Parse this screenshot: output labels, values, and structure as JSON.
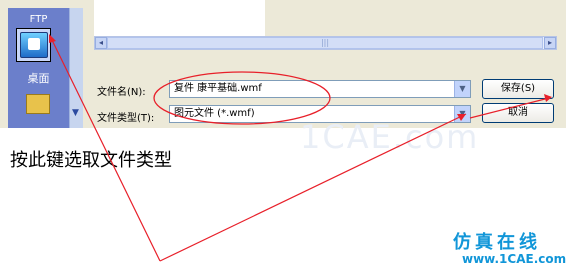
{
  "places_bar": {
    "top_label": "FTP",
    "desktop_label": "桌面"
  },
  "dialog": {
    "filename_label": "文件名(N):",
    "filename_value": "复件 康平基础.wmf",
    "filetype_label": "文件类型(T):",
    "filetype_value": "图元文件 (*.wmf)",
    "save_button": "保存(S)",
    "cancel_button": "取消"
  },
  "caption": "按此键选取文件类型",
  "watermark": {
    "text": "1CAE.com"
  },
  "logo": {
    "text": "仿真在线",
    "url": "www.1CAE.com"
  },
  "colors": {
    "annotation": "#e8202a",
    "logo": "#1196d8",
    "places_bar": "#6b7fcb"
  },
  "icons": [
    "desktop-icon",
    "folder-icon",
    "dropdown-arrow-icon",
    "scroll-left-icon",
    "scroll-right-icon"
  ]
}
